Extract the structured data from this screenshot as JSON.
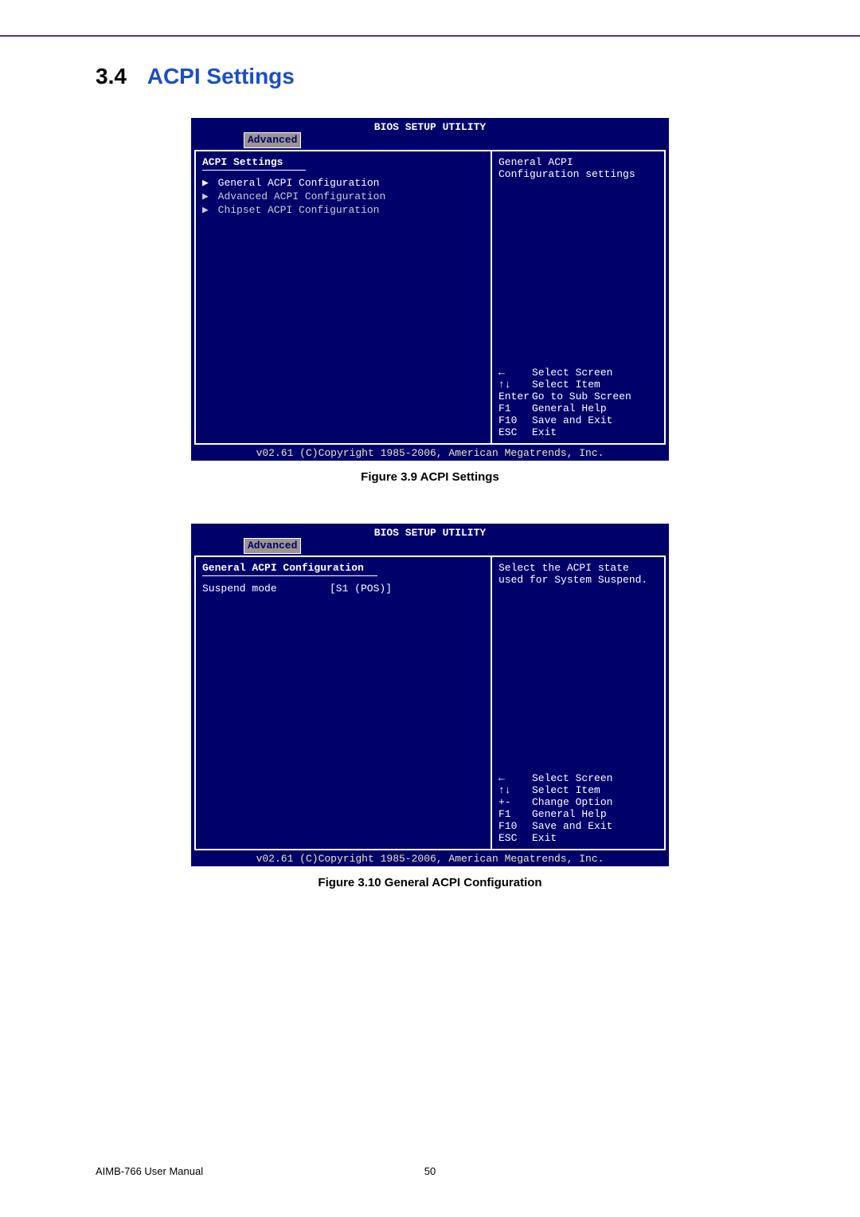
{
  "section": {
    "number": "3.4",
    "title": "ACPI Settings"
  },
  "bios1": {
    "title": "BIOS SETUP UTILITY",
    "tab": "Advanced",
    "heading": "ACPI Settings",
    "items": [
      "General ACPI Configuration",
      "Advanced ACPI Configuration",
      "Chipset ACPI Configuration"
    ],
    "help": "General ACPI Configuration settings",
    "nav": [
      {
        "key": "←",
        "desc": "Select Screen"
      },
      {
        "key": "↑↓",
        "desc": "Select Item"
      },
      {
        "key": "Enter",
        "desc": "Go to Sub Screen"
      },
      {
        "key": "F1",
        "desc": "General Help"
      },
      {
        "key": "F10",
        "desc": "Save and Exit"
      },
      {
        "key": "ESC",
        "desc": "Exit"
      }
    ],
    "footer": "v02.61 (C)Copyright 1985-2006, American Megatrends, Inc."
  },
  "caption1": "Figure 3.9 ACPI Settings",
  "bios2": {
    "title": "BIOS SETUP UTILITY",
    "tab": "Advanced",
    "heading": "General ACPI Configuration",
    "option_label": "Suspend mode",
    "option_value": "[S1 (POS)]",
    "help": "Select the ACPI state used for System Suspend.",
    "nav": [
      {
        "key": "←",
        "desc": "Select Screen"
      },
      {
        "key": "↑↓",
        "desc": "Select Item"
      },
      {
        "key": "+-",
        "desc": "Change Option"
      },
      {
        "key": "F1",
        "desc": "General Help"
      },
      {
        "key": "F10",
        "desc": "Save and Exit"
      },
      {
        "key": "ESC",
        "desc": "Exit"
      }
    ],
    "footer": "v02.61 (C)Copyright 1985-2006, American Megatrends, Inc."
  },
  "caption2": "Figure 3.10 General ACPI Configuration",
  "manual": "AIMB-766 User Manual",
  "page": "50"
}
